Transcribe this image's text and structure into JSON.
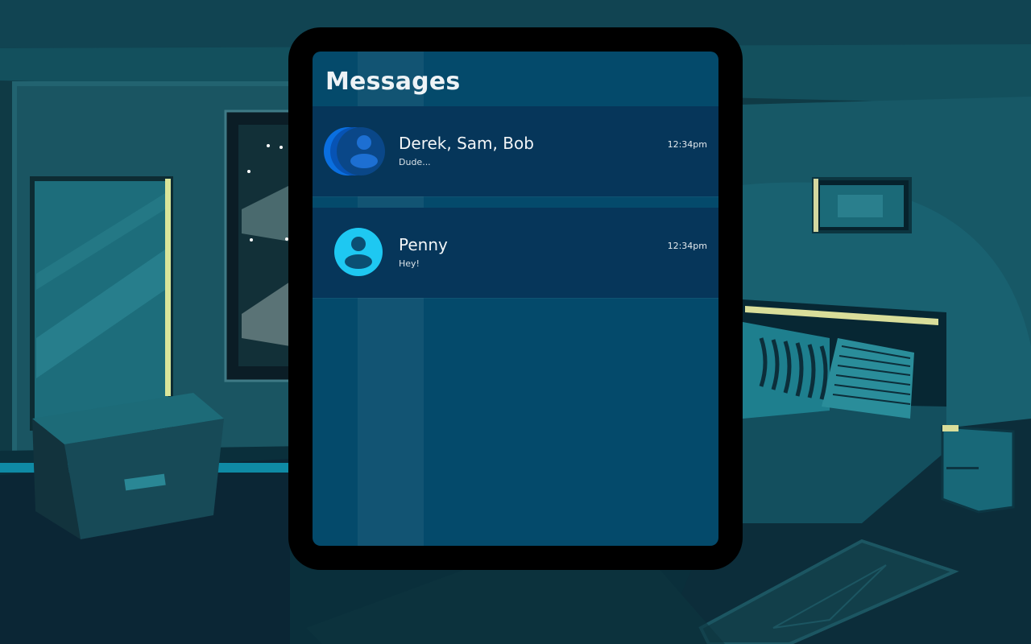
{
  "app": {
    "title": "Messages"
  },
  "threads": [
    {
      "name": "Derek, Sam, Bob",
      "preview": "Dude...",
      "time": "12:34pm",
      "avatar": "group-avatar-icon"
    },
    {
      "name": "Penny",
      "preview": "Hey!",
      "time": "12:34pm",
      "avatar": "user-avatar-icon"
    }
  ],
  "colors": {
    "screen_bg": "#044a6b",
    "row_bg": "#06365a",
    "accent": "#1ec8f2",
    "group_avatar": "#0a6fe0"
  }
}
